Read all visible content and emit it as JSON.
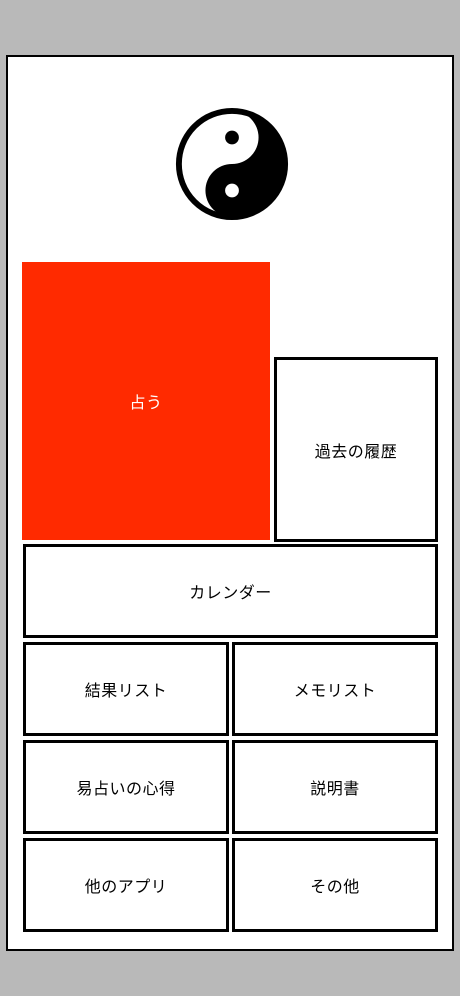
{
  "colors": {
    "background": "#b9b9b9",
    "screen": "#ffffff",
    "accent": "#ff2a00",
    "border": "#000000"
  },
  "logo": {
    "icon": "yin-yang-icon"
  },
  "buttons": {
    "divine": "占う",
    "history": "過去の履歴",
    "calendar": "カレンダー",
    "result_list": "結果リスト",
    "memo_list": "メモリスト",
    "tips": "易占いの心得",
    "manual": "説明書",
    "other_apps": "他のアプリ",
    "other": "その他"
  }
}
